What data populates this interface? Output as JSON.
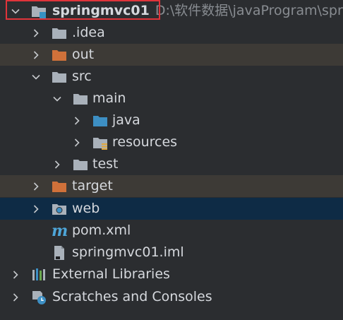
{
  "project": {
    "name": "springmvc01",
    "path": "D:\\软件数据\\javaProgram\\sprin"
  },
  "items": {
    "idea": ".idea",
    "out": "out",
    "src": "src",
    "main": "main",
    "java": "java",
    "resources": "resources",
    "test": "test",
    "target": "target",
    "web": "web",
    "pom": "pom.xml",
    "iml": "springmvc01.iml",
    "external_libraries": "External Libraries",
    "scratches": "Scratches and Consoles"
  },
  "colors": {
    "background": "#2b2d30",
    "excluded_row": "#3d3a36",
    "selected_row": "#0e2b45",
    "folder_gray": "#a9b1ba",
    "folder_orange": "#d0713a",
    "folder_blue": "#3d8fc4",
    "highlight_border": "#e0343a"
  },
  "icons": {
    "expanded": "chevron-down-icon",
    "collapsed": "chevron-right-icon",
    "module": "module-folder-icon",
    "folder": "folder-icon",
    "excluded_folder": "excluded-folder-icon",
    "source_folder": "source-folder-icon",
    "resources_folder": "resources-folder-icon",
    "web_folder": "web-folder-icon",
    "maven_file": "maven-icon",
    "iml_file": "iml-file-icon",
    "libraries": "libraries-icon",
    "scratches": "scratches-icon"
  }
}
